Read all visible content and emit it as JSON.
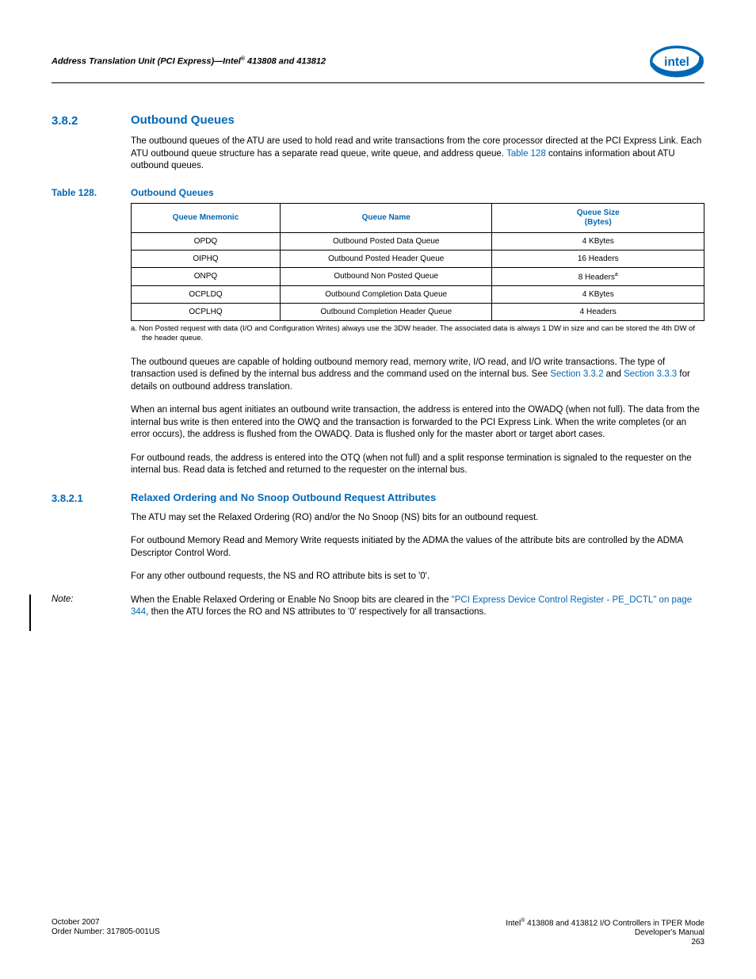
{
  "header": {
    "breadcrumb": "Address Translation Unit (PCI Express)—Intel® 413808 and 413812"
  },
  "section382": {
    "num": "3.8.2",
    "title": "Outbound Queues",
    "para1a": "The outbound queues of the ATU are used to hold read and write transactions from the core processor directed at the PCI Express Link. Each ATU outbound queue structure has a separate read queue, write queue, and address queue. ",
    "para1_link": "Table 128",
    "para1b": " contains information about ATU outbound queues."
  },
  "table128": {
    "caption_num": "Table 128.",
    "caption_title": "Outbound Queues",
    "headers": [
      "Queue Mnemonic",
      "Queue Name",
      "Queue Size\n(Bytes)"
    ],
    "rows": [
      {
        "mnemonic": "OPDQ",
        "name": "Outbound Posted Data Queue",
        "size": "4 KBytes"
      },
      {
        "mnemonic": "OIPHQ",
        "name": "Outbound Posted Header Queue",
        "size": "16 Headers"
      },
      {
        "mnemonic": "ONPQ",
        "name": "Outbound Non Posted Queue",
        "size": "8 Headers",
        "size_sup": "a"
      },
      {
        "mnemonic": "OCPLDQ",
        "name": "Outbound Completion Data Queue",
        "size": "4 KBytes"
      },
      {
        "mnemonic": "OCPLHQ",
        "name": "Outbound Completion Header Queue",
        "size": "4 Headers"
      }
    ],
    "footnote": "a.  Non Posted request with data (I/O and Configuration Writes) always use the 3DW header. The associated data is always 1 DW in size and can be stored the 4th DW of the header queue."
  },
  "after_table": {
    "para2a": "The outbound queues are capable of holding outbound memory read, memory write, I/O read, and I/O write transactions. The type of transaction used is defined by the internal bus address and the command used on the internal bus. See ",
    "para2_link1": "Section 3.3.2",
    "para2b": " and ",
    "para2_link2": "Section 3.3.3",
    "para2c": " for details on outbound address translation.",
    "para3": "When an internal bus agent initiates an outbound write transaction, the address is entered into the OWADQ (when not full). The data from the internal bus write is then entered into the OWQ and the transaction is forwarded to the PCI Express Link. When the write completes (or an error occurs), the address is flushed from the OWADQ. Data is flushed only for the master abort or target abort cases.",
    "para4": "For outbound reads, the address is entered into the OTQ (when not full) and a split response termination is signaled to the requester on the internal bus. Read data is fetched and returned to the requester on the internal bus."
  },
  "section3821": {
    "num": "3.8.2.1",
    "title": "Relaxed Ordering and No Snoop Outbound Request Attributes",
    "para1": "The ATU may set the Relaxed Ordering (RO) and/or the No Snoop (NS) bits for an outbound request.",
    "para2": "For outbound Memory Read and Memory Write requests initiated by the ADMA the values of the attribute bits are controlled by the ADMA Descriptor Control Word.",
    "para3": "For any other outbound requests, the NS and RO attribute bits is set to '0'."
  },
  "note": {
    "label": "Note:",
    "body_a": "When the Enable Relaxed Ordering or Enable No Snoop bits are cleared in the ",
    "body_link": "\"PCI Express Device Control Register - PE_DCTL\" on page 344",
    "body_b": ", then the ATU forces the RO and NS attributes to '0' respectively for all transactions."
  },
  "footer": {
    "left_line1": "October 2007",
    "left_line2": "Order Number: 317805-001US",
    "right_line1": "Intel® 413808 and 413812 I/O Controllers in TPER Mode",
    "right_line2": "Developer's Manual",
    "right_line3": "263"
  }
}
